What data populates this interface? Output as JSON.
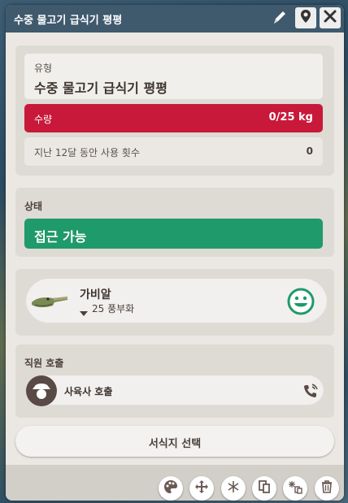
{
  "window": {
    "title": "수중 물고기 급식기 평평"
  },
  "info": {
    "type_label": "유형",
    "type_value": "수중 물고기 급식기 평평",
    "capacity_label": "수량",
    "capacity_value": "0/25 kg",
    "usage_label": "지난 12달 동안 사용 횟수",
    "usage_value": "0"
  },
  "status": {
    "heading": "상태",
    "value": "접근 가능"
  },
  "animal": {
    "name": "가비알",
    "group": "25 풍부화",
    "mood_icon": "happy-face-icon"
  },
  "staff": {
    "heading": "직원 호출",
    "call_label": "사육사 호출"
  },
  "actions": {
    "select_habitat_label": "서식지 선택"
  },
  "toolbar": {
    "buttons": [
      "palette-icon",
      "move-icon",
      "snowflake-icon",
      "duplicate-icon",
      "duplicate-attached-icon",
      "trash-icon"
    ]
  },
  "colors": {
    "titlebar": "#3f596d",
    "capacity_bar": "#c8193a",
    "status_bar": "#1f9a6a",
    "panel": "#ebe8e3"
  }
}
